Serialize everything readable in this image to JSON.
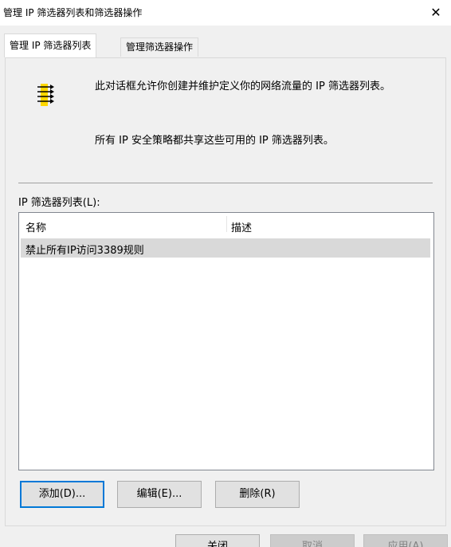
{
  "window": {
    "title": "管理 IP 筛选器列表和筛选器操作",
    "close_glyph": "✕"
  },
  "tabs": [
    {
      "label": "管理 IP 筛选器列表",
      "active": true
    },
    {
      "label": "管理筛选器操作",
      "active": false
    }
  ],
  "panel": {
    "icon": "filter-list-icon",
    "description_1": "此对话框允许你创建并维护定义你的网络流量的 IP 筛选器列表。",
    "description_2": "所有 IP 安全策略都共享这些可用的 IP 筛选器列表。",
    "list_label": "IP 筛选器列表(L):",
    "columns": [
      "名称",
      "描述"
    ],
    "rows": [
      {
        "name": "禁止所有IP访问3389规则",
        "description": ""
      }
    ],
    "buttons": {
      "add": "添加(D)...",
      "edit": "编辑(E)...",
      "remove": "删除(R)"
    }
  },
  "footer": {
    "close": "关闭",
    "cancel": "取消",
    "apply": "应用(A)"
  },
  "colors": {
    "accent": "#0078d7",
    "icon_yellow": "#ffd800",
    "selection": "#d9d9d9"
  }
}
